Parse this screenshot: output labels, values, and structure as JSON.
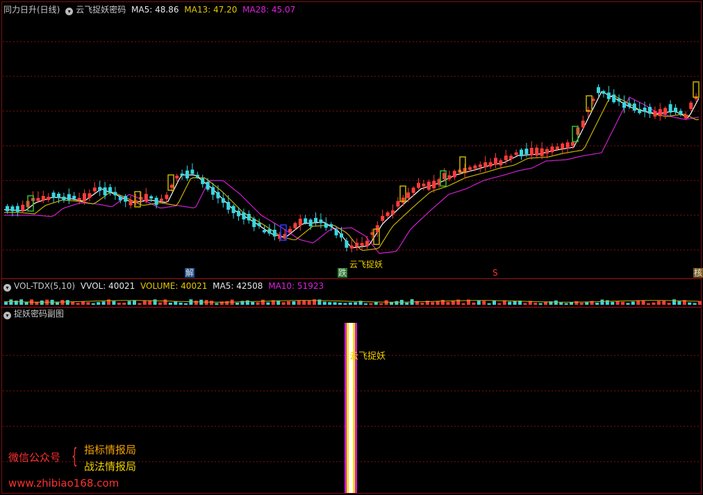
{
  "main": {
    "stock_label": "同力日升(日线)",
    "indicator_name": "云飞捉妖密码",
    "ma5": "MA5: 48.86",
    "ma13": "MA13: 47.20",
    "ma28": "MA28: 45.07"
  },
  "markers": {
    "jie": "解",
    "die": "跌",
    "yunfei": "云飞捉妖",
    "s": "S",
    "right": "核"
  },
  "volume": {
    "name": "VOL-TDX(5,10)",
    "vvol": "VVOL: 40021",
    "volume": "VOLUME: 40021",
    "ma5": "MA5: 42508",
    "ma10": "MA10: 51923"
  },
  "sub": {
    "name": "捉妖密码副图",
    "signal_label": "云飞捉妖"
  },
  "watermark": {
    "wechat": "微信公众号",
    "line1": "指标情报局",
    "line2": "战法情报局",
    "url": "www.zhibiao168.com"
  },
  "colors": {
    "up": "#ff3b3b",
    "down": "#3ad6e0",
    "ma5": "#ffffff",
    "ma13": "#c8b400",
    "ma28": "#d020d0",
    "grid": "#8a1010"
  }
}
